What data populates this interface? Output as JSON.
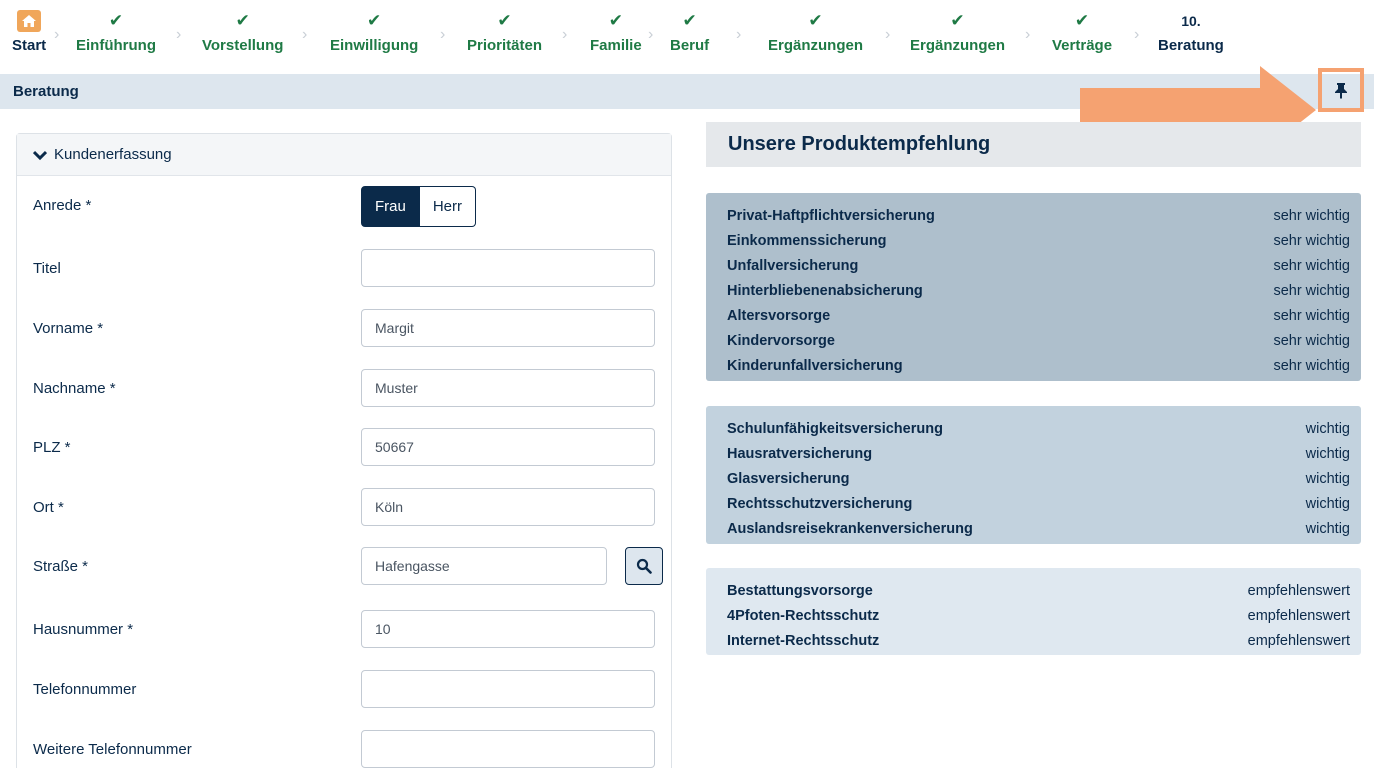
{
  "stepper": {
    "steps": [
      {
        "label": "Start",
        "kind": "home"
      },
      {
        "label": "Einführung",
        "kind": "done"
      },
      {
        "label": "Vorstellung",
        "kind": "done"
      },
      {
        "label": "Einwilligung",
        "kind": "done"
      },
      {
        "label": "Prioritäten",
        "kind": "done"
      },
      {
        "label": "Familie",
        "kind": "done"
      },
      {
        "label": "Beruf",
        "kind": "done"
      },
      {
        "label": "Ergänzungen",
        "kind": "done"
      },
      {
        "label": "Ergänzungen",
        "kind": "done"
      },
      {
        "label": "Verträge",
        "kind": "done"
      },
      {
        "label": "Beratung",
        "kind": "current",
        "number": "10."
      }
    ],
    "done_icon": "check-icon",
    "home_icon": "home-icon",
    "separator_icon": "chevron-right-icon"
  },
  "header": {
    "title": "Beratung",
    "pin_icon": "pin-icon"
  },
  "form": {
    "section_title": "Kundenerfassung",
    "salutation": {
      "label": "Anrede *",
      "options": [
        "Frau",
        "Herr"
      ],
      "selected": "Frau"
    },
    "fields": {
      "titel": {
        "label": "Titel",
        "value": ""
      },
      "vorname": {
        "label": "Vorname *",
        "value": "Margit"
      },
      "nachname": {
        "label": "Nachname *",
        "value": "Muster"
      },
      "plz": {
        "label": "PLZ *",
        "value": "50667"
      },
      "ort": {
        "label": "Ort *",
        "value": "Köln"
      },
      "strasse": {
        "label": "Straße *",
        "value": "Hafengasse"
      },
      "hausnummer": {
        "label": "Hausnummer *",
        "value": "10"
      },
      "telefon": {
        "label": "Telefonnummer",
        "value": ""
      },
      "telefon2": {
        "label": "Weitere Telefonnummer",
        "value": ""
      }
    }
  },
  "recommendation": {
    "title": "Unsere Produktempfehlung",
    "groups": [
      {
        "color": "#aebfcc",
        "items": [
          {
            "name": "Privat-Haftpflichtversicherung",
            "priority": "sehr wichtig"
          },
          {
            "name": "Einkommenssicherung",
            "priority": "sehr wichtig"
          },
          {
            "name": "Unfallversicherung",
            "priority": "sehr wichtig"
          },
          {
            "name": "Hinterbliebenenabsicherung",
            "priority": "sehr wichtig"
          },
          {
            "name": "Altersvorsorge",
            "priority": "sehr wichtig"
          },
          {
            "name": "Kindervorsorge",
            "priority": "sehr wichtig"
          },
          {
            "name": "Kinderunfallversicherung",
            "priority": "sehr wichtig"
          }
        ]
      },
      {
        "color": "#c2d2de",
        "items": [
          {
            "name": "Schulunfähigkeitsversicherung",
            "priority": "wichtig"
          },
          {
            "name": "Hausratversicherung",
            "priority": "wichtig"
          },
          {
            "name": "Glasversicherung",
            "priority": "wichtig"
          },
          {
            "name": "Rechtsschutzversicherung",
            "priority": "wichtig"
          },
          {
            "name": "Auslandsreisekrankenversicherung",
            "priority": "wichtig"
          }
        ]
      },
      {
        "color": "#dfe8f0",
        "items": [
          {
            "name": "Bestattungsvorsorge",
            "priority": "empfehlenswert"
          },
          {
            "name": "4Pfoten-Rechtsschutz",
            "priority": "empfehlenswert"
          },
          {
            "name": "Internet-Rechtsschutz",
            "priority": "empfehlenswert"
          }
        ]
      }
    ]
  },
  "colors": {
    "accent_dark": "#0b2a4a",
    "done_green": "#1f7a45",
    "home_orange": "#f0a65a",
    "annotation_orange": "#f5a271"
  }
}
